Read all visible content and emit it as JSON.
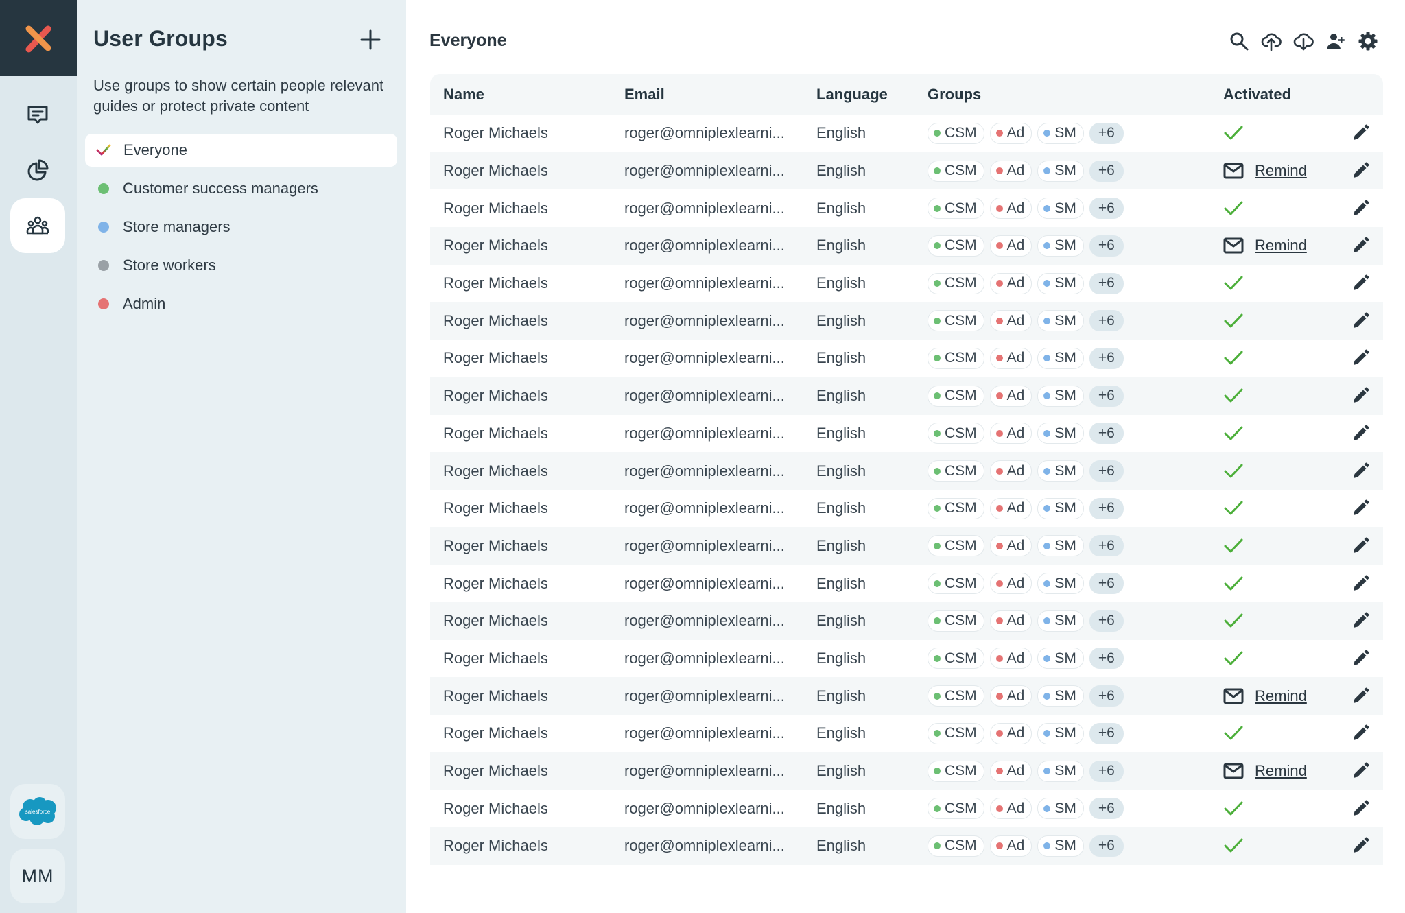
{
  "rail": {
    "logo_icon": "omniplex-x-logo",
    "items": [
      {
        "name": "messages",
        "icon": "chat-icon",
        "active": false
      },
      {
        "name": "analytics",
        "icon": "pie-chart-icon",
        "active": false
      },
      {
        "name": "user-groups",
        "icon": "users-icon",
        "active": true
      }
    ],
    "integration_label": "salesforce",
    "avatar_initials": "MM"
  },
  "groups_panel": {
    "title": "User Groups",
    "add_icon": "plus-icon",
    "description": "Use groups to show certain people relevant guides or protect private content",
    "groups": [
      {
        "label": "Everyone",
        "color": "rainbow",
        "selected": true
      },
      {
        "label": "Customer success managers",
        "color": "#6cbf73",
        "selected": false
      },
      {
        "label": "Store managers",
        "color": "#7fb3e8",
        "selected": false
      },
      {
        "label": "Store workers",
        "color": "#9aa1a6",
        "selected": false
      },
      {
        "label": "Admin",
        "color": "#e57373",
        "selected": false
      }
    ]
  },
  "main": {
    "title": "Everyone",
    "toolbar": [
      {
        "name": "search",
        "icon": "search-icon"
      },
      {
        "name": "upload",
        "icon": "cloud-upload-icon"
      },
      {
        "name": "download",
        "icon": "cloud-download-icon"
      },
      {
        "name": "add-user",
        "icon": "add-user-icon"
      },
      {
        "name": "settings",
        "icon": "gear-icon"
      }
    ],
    "columns": [
      "Name",
      "Email",
      "Language",
      "Groups",
      "Activated"
    ],
    "chips": [
      {
        "label": "CSM",
        "color": "#6cbf73"
      },
      {
        "label": "Ad",
        "color": "#e57373"
      },
      {
        "label": "SM",
        "color": "#7fb3e8"
      }
    ],
    "remind_label": "Remind",
    "rows": [
      {
        "name": "Roger Michaels",
        "email": "roger@omniplexlearni...",
        "language": "English",
        "groups": [
          "CSM",
          "Ad",
          "SM"
        ],
        "more": "+6",
        "activated": true
      },
      {
        "name": "Roger Michaels",
        "email": "roger@omniplexlearni...",
        "language": "English",
        "groups": [
          "CSM",
          "Ad",
          "SM"
        ],
        "more": "+6",
        "activated": false
      },
      {
        "name": "Roger Michaels",
        "email": "roger@omniplexlearni...",
        "language": "English",
        "groups": [
          "CSM",
          "Ad",
          "SM"
        ],
        "more": "+6",
        "activated": true
      },
      {
        "name": "Roger Michaels",
        "email": "roger@omniplexlearni...",
        "language": "English",
        "groups": [
          "CSM",
          "Ad",
          "SM"
        ],
        "more": "+6",
        "activated": false
      },
      {
        "name": "Roger Michaels",
        "email": "roger@omniplexlearni...",
        "language": "English",
        "groups": [
          "CSM",
          "Ad",
          "SM"
        ],
        "more": "+6",
        "activated": true
      },
      {
        "name": "Roger Michaels",
        "email": "roger@omniplexlearni...",
        "language": "English",
        "groups": [
          "CSM",
          "Ad",
          "SM"
        ],
        "more": "+6",
        "activated": true
      },
      {
        "name": "Roger Michaels",
        "email": "roger@omniplexlearni...",
        "language": "English",
        "groups": [
          "CSM",
          "Ad",
          "SM"
        ],
        "more": "+6",
        "activated": true
      },
      {
        "name": "Roger Michaels",
        "email": "roger@omniplexlearni...",
        "language": "English",
        "groups": [
          "CSM",
          "Ad",
          "SM"
        ],
        "more": "+6",
        "activated": true
      },
      {
        "name": "Roger Michaels",
        "email": "roger@omniplexlearni...",
        "language": "English",
        "groups": [
          "CSM",
          "Ad",
          "SM"
        ],
        "more": "+6",
        "activated": true
      },
      {
        "name": "Roger Michaels",
        "email": "roger@omniplexlearni...",
        "language": "English",
        "groups": [
          "CSM",
          "Ad",
          "SM"
        ],
        "more": "+6",
        "activated": true
      },
      {
        "name": "Roger Michaels",
        "email": "roger@omniplexlearni...",
        "language": "English",
        "groups": [
          "CSM",
          "Ad",
          "SM"
        ],
        "more": "+6",
        "activated": true
      },
      {
        "name": "Roger Michaels",
        "email": "roger@omniplexlearni...",
        "language": "English",
        "groups": [
          "CSM",
          "Ad",
          "SM"
        ],
        "more": "+6",
        "activated": true
      },
      {
        "name": "Roger Michaels",
        "email": "roger@omniplexlearni...",
        "language": "English",
        "groups": [
          "CSM",
          "Ad",
          "SM"
        ],
        "more": "+6",
        "activated": true
      },
      {
        "name": "Roger Michaels",
        "email": "roger@omniplexlearni...",
        "language": "English",
        "groups": [
          "CSM",
          "Ad",
          "SM"
        ],
        "more": "+6",
        "activated": true
      },
      {
        "name": "Roger Michaels",
        "email": "roger@omniplexlearni...",
        "language": "English",
        "groups": [
          "CSM",
          "Ad",
          "SM"
        ],
        "more": "+6",
        "activated": true
      },
      {
        "name": "Roger Michaels",
        "email": "roger@omniplexlearni...",
        "language": "English",
        "groups": [
          "CSM",
          "Ad",
          "SM"
        ],
        "more": "+6",
        "activated": false
      },
      {
        "name": "Roger Michaels",
        "email": "roger@omniplexlearni...",
        "language": "English",
        "groups": [
          "CSM",
          "Ad",
          "SM"
        ],
        "more": "+6",
        "activated": true
      },
      {
        "name": "Roger Michaels",
        "email": "roger@omniplexlearni...",
        "language": "English",
        "groups": [
          "CSM",
          "Ad",
          "SM"
        ],
        "more": "+6",
        "activated": false
      },
      {
        "name": "Roger Michaels",
        "email": "roger@omniplexlearni...",
        "language": "English",
        "groups": [
          "CSM",
          "Ad",
          "SM"
        ],
        "more": "+6",
        "activated": true
      },
      {
        "name": "Roger Michaels",
        "email": "roger@omniplexlearni...",
        "language": "English",
        "groups": [
          "CSM",
          "Ad",
          "SM"
        ],
        "more": "+6",
        "activated": true
      }
    ]
  },
  "colors": {
    "rail_dark": "#263640",
    "logo_orange": "#f0954a",
    "logo_coral": "#e8584f",
    "check_green": "#4caf3a",
    "salesforce_blue": "#1798c1"
  }
}
